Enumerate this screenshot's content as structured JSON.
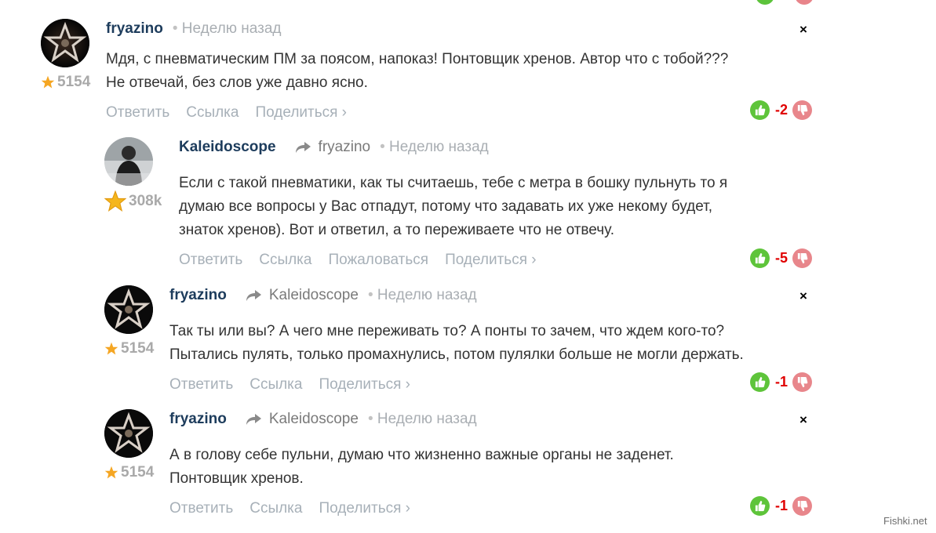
{
  "comments": [
    {
      "author": "fryazino",
      "reply_to": "",
      "time": "Неделю назад",
      "karma": "5154",
      "text_lines": [
        "Мдя, с пневматическим ПМ за поясом, напоказ! Понтовщик хренов. Автор что с тобой???",
        "Не отвечай, без слов уже давно ясно."
      ],
      "actions": [
        "Ответить",
        "Ссылка",
        "Поделиться ›"
      ],
      "score": "-2",
      "close": "×"
    },
    {
      "author": "Kaleidoscope",
      "reply_to": "fryazino",
      "time": "Неделю назад",
      "karma": "308k",
      "text_lines": [
        "Если с такой пневматики, как ты считаешь, тебе с метра в бошку пульнуть то я",
        "думаю все вопросы у Вас отпадут, потому что задавать их уже некому будет,",
        "знаток хренов). Вот и ответил, а то переживаете что не отвечу."
      ],
      "actions": [
        "Ответить",
        "Ссылка",
        "Пожаловаться",
        "Поделиться ›"
      ],
      "score": "-5",
      "close": ""
    },
    {
      "author": "fryazino",
      "reply_to": "Kaleidoscope",
      "time": "Неделю назад",
      "karma": "5154",
      "text_lines": [
        "Так ты или вы? А чего мне переживать то? А понты то зачем, что ждем кого-то?",
        "Пытались пулять, только промахнулись, потом пулялки больше не могли держать."
      ],
      "actions": [
        "Ответить",
        "Ссылка",
        "Поделиться ›"
      ],
      "score": "-1",
      "close": "×"
    },
    {
      "author": "fryazino",
      "reply_to": "Kaleidoscope",
      "time": "Неделю назад",
      "karma": "5154",
      "text_lines": [
        "А в голову себе пульни, думаю что жизненно важные органы не заденет.",
        "Понтовщик хренов."
      ],
      "actions": [
        "Ответить",
        "Ссылка",
        "Поделиться ›"
      ],
      "score": "-1",
      "close": "×"
    }
  ],
  "watermark": "Fishki.net",
  "colors": {
    "author": "#1d3c5c",
    "action": "#a7b0b8",
    "score": "#e00000",
    "vote_up": "#5ec43a",
    "vote_down": "#e8868b",
    "karma": "#a9a9a9"
  },
  "icons": {
    "reply": "reply-arrow-icon",
    "star": "star-icon",
    "up": "thumb-up-icon",
    "down": "thumb-down-icon",
    "close": "close-icon"
  }
}
